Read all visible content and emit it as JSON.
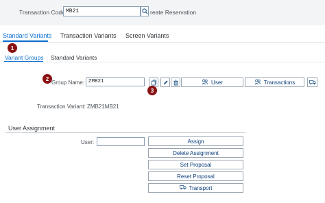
{
  "header": {
    "tcode_label": "Transaction Code:",
    "tcode_value": "MB21",
    "tcode_desc": "reate Reservation"
  },
  "tabs": [
    {
      "label": "Standard Variants",
      "active": true
    },
    {
      "label": "Transaction Variants",
      "active": false
    },
    {
      "label": "Screen Variants",
      "active": false
    }
  ],
  "subtabs": [
    {
      "label": "Variant Groups",
      "active": true
    },
    {
      "label": "Standard Variants",
      "active": false
    }
  ],
  "badges": [
    "1",
    "2",
    "3"
  ],
  "group": {
    "label": "Group Name:",
    "value": "ZMB21",
    "user_button": "User",
    "transactions_button": "Transactions"
  },
  "variant": {
    "label": "Transaction Variant:",
    "value": "ZMB21MB21"
  },
  "user_assignment": {
    "title": "User Assignment",
    "user_label": "User:",
    "user_value": "",
    "buttons": [
      "Assign",
      "Delete Assignment",
      "Set Proposal",
      "Reset Proposal",
      "Transport"
    ]
  },
  "colors": {
    "accent": "#0a6ed1",
    "badge": "#8a1214"
  }
}
